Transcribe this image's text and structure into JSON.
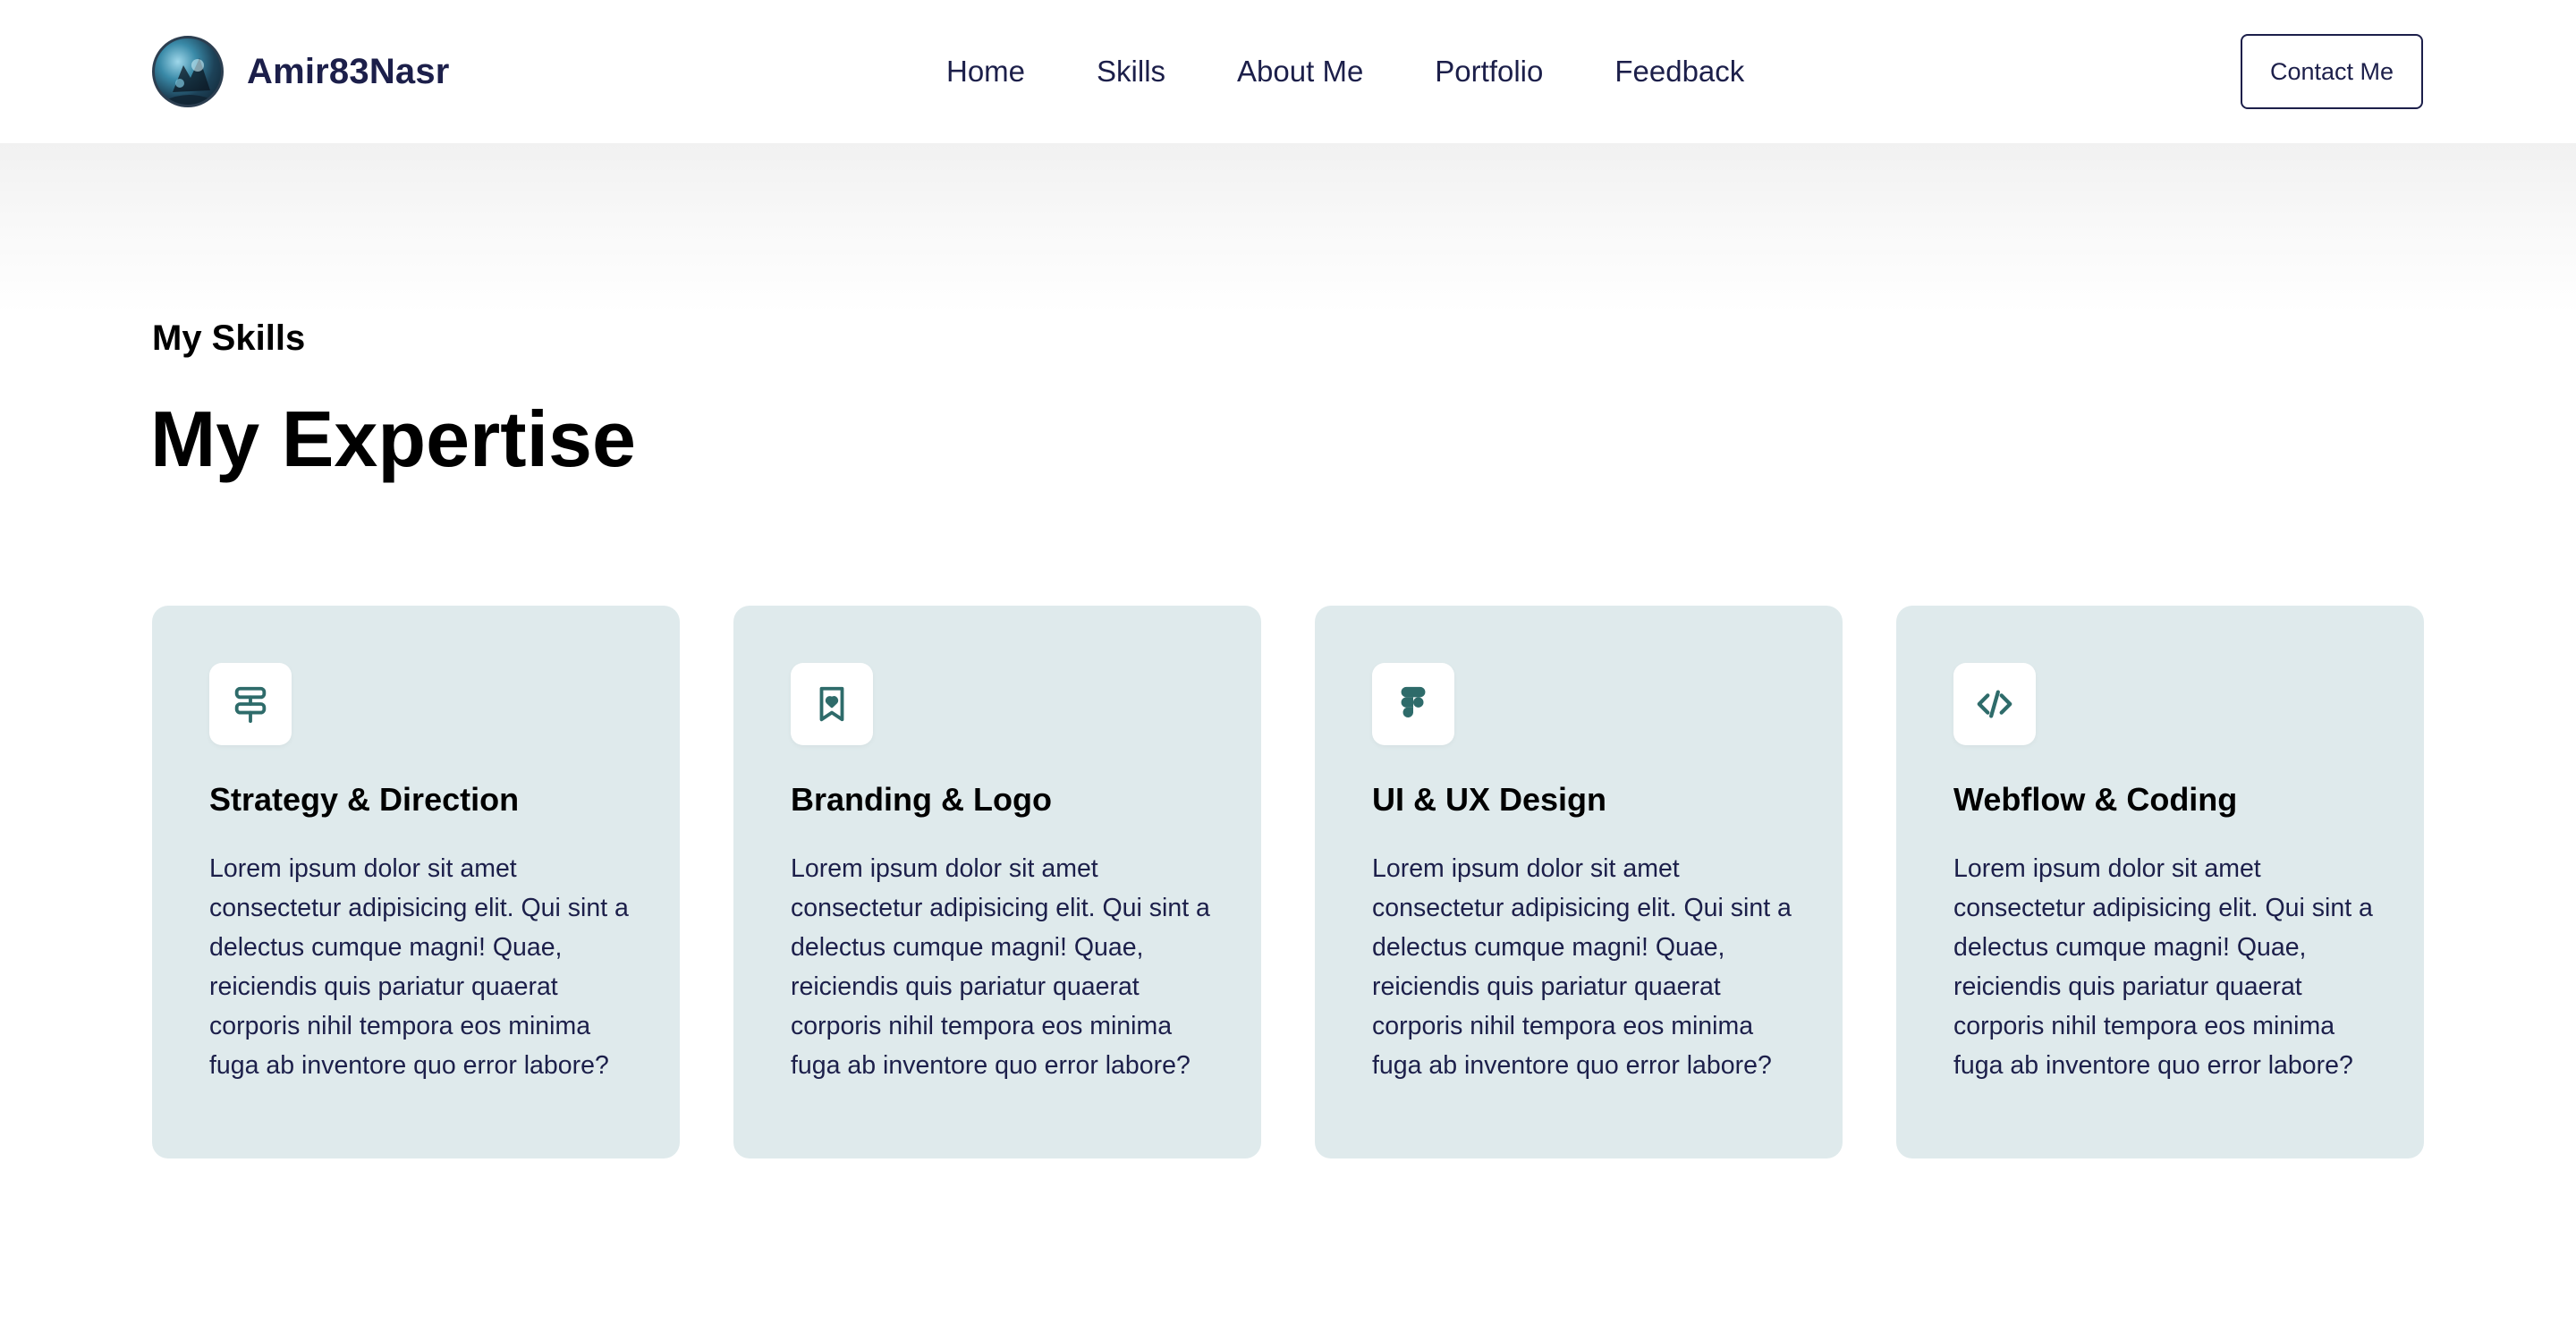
{
  "navbar": {
    "brand_name": "Amir83Nasr",
    "links": [
      {
        "label": "Home"
      },
      {
        "label": "Skills"
      },
      {
        "label": "About Me"
      },
      {
        "label": "Portfolio"
      },
      {
        "label": "Feedback"
      }
    ],
    "contact_label": "Contact Me"
  },
  "section": {
    "kicker": "My Skills",
    "title": "My Expertise"
  },
  "cards": [
    {
      "icon": "signpost-icon",
      "title": "Strategy & Direction",
      "text": "Lorem ipsum dolor sit amet consectetur adipisicing elit. Qui sint a delectus cumque magni! Quae, reiciendis quis pariatur quaerat corporis nihil tempora eos minima fuga ab inventore quo error labore?"
    },
    {
      "icon": "bookmark-heart-icon",
      "title": "Branding & Logo",
      "text": "Lorem ipsum dolor sit amet consectetur adipisicing elit. Qui sint a delectus cumque magni! Quae, reiciendis quis pariatur quaerat corporis nihil tempora eos minima fuga ab inventore quo error labore?"
    },
    {
      "icon": "figma-icon",
      "title": "UI & UX Design",
      "text": "Lorem ipsum dolor sit amet consectetur adipisicing elit. Qui sint a delectus cumque magni! Quae, reiciendis quis pariatur quaerat corporis nihil tempora eos minima fuga ab inventore quo error labore?"
    },
    {
      "icon": "code-icon",
      "title": "Webflow & Coding",
      "text": "Lorem ipsum dolor sit amet consectetur adipisicing elit. Qui sint a delectus cumque magni! Quae, reiciendis quis pariatur quaerat corporis nihil tempora eos minima fuga ab inventore quo error labore?"
    }
  ],
  "colors": {
    "brand_text": "#1c1f4a",
    "card_bg": "#dfeaec",
    "icon_accent": "#2e6b6a"
  }
}
